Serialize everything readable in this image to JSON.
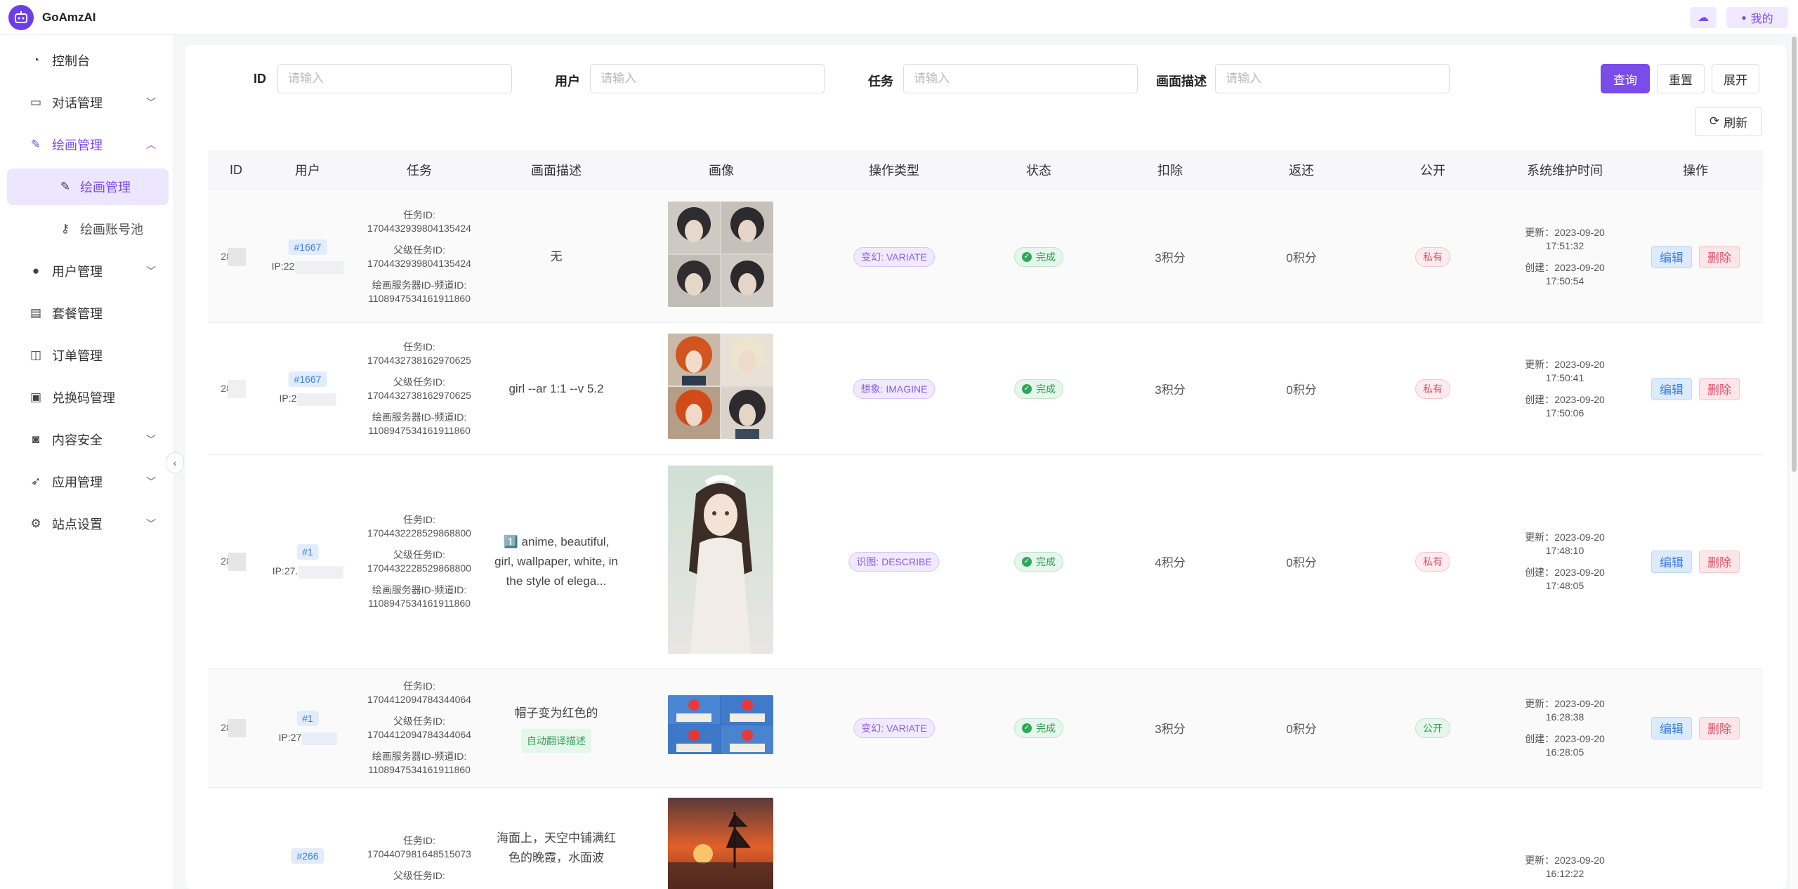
{
  "app": {
    "title": "GoAmzAI",
    "logo_icon": "robot-icon"
  },
  "topbar": {
    "theme_icon": "weather-icon",
    "user_label": "我的"
  },
  "sidebar": {
    "items": [
      {
        "label": "控制台",
        "icon": "dashboard-icon"
      },
      {
        "label": "对话管理",
        "icon": "chat-icon"
      },
      {
        "label": "绘画管理",
        "icon": "paint-icon"
      },
      {
        "label": "绘画管理",
        "icon": "paint-icon"
      },
      {
        "label": "绘画账号池",
        "icon": "key-icon"
      },
      {
        "label": "用户管理",
        "icon": "user-icon"
      },
      {
        "label": "套餐管理",
        "icon": "package-icon"
      },
      {
        "label": "订单管理",
        "icon": "bag-icon"
      },
      {
        "label": "兑换码管理",
        "icon": "gift-icon"
      },
      {
        "label": "内容安全",
        "icon": "shield-icon"
      },
      {
        "label": "应用管理",
        "icon": "rocket-icon"
      },
      {
        "label": "站点设置",
        "icon": "settings-icon"
      }
    ]
  },
  "filters": {
    "id_label": "ID",
    "user_label": "用户",
    "task_label": "任务",
    "desc_label": "画面描述",
    "placeholder": "请输入"
  },
  "buttons": {
    "query": "查询",
    "reset": "重置",
    "expand": "展开",
    "refresh": "刷新"
  },
  "table": {
    "headers": [
      "ID",
      "用户",
      "任务",
      "画面描述",
      "画像",
      "操作类型",
      "状态",
      "扣除",
      "返还",
      "公开",
      "系统维护时间",
      "操作"
    ],
    "task_id_label": "任务ID:",
    "parent_task_label": "父级任务ID:",
    "server_label": "绘画服务器ID-频道ID:",
    "updated_label": "更新：",
    "created_label": "创建：",
    "edit_label": "编辑",
    "delete_label": "删除",
    "rows": [
      {
        "id": "28",
        "user_tag": "#1667",
        "ip": "IP:22",
        "task_id": "1704432939804135424",
        "parent_id": "1704432939804135424",
        "server": "1108947534161911860",
        "desc": "无",
        "auto_tag": "",
        "op": "变幻: VARIATE",
        "status": "完成",
        "deduct": "3积分",
        "refund": "0积分",
        "public": "私有",
        "updated_date": "2023-09-20",
        "updated_time": "17:51:32",
        "created_date": "2023-09-20",
        "created_time": "17:50:54"
      },
      {
        "id": "28",
        "user_tag": "#1667",
        "ip": "IP:2",
        "task_id": "1704432738162970625",
        "parent_id": "1704432738162970625",
        "server": "1108947534161911860",
        "desc": "girl --ar 1:1 --v 5.2",
        "auto_tag": "",
        "op": "想象: IMAGINE",
        "status": "完成",
        "deduct": "3积分",
        "refund": "0积分",
        "public": "私有",
        "updated_date": "2023-09-20",
        "updated_time": "17:50:41",
        "created_date": "2023-09-20",
        "created_time": "17:50:06"
      },
      {
        "id": "28",
        "user_tag": "#1",
        "ip": "IP:27.",
        "task_id": "1704432228529868800",
        "parent_id": "1704432228529868800",
        "server": "1108947534161911860",
        "desc": "1️⃣ anime, beautiful, girl, wallpaper, white, in the style of elega...",
        "auto_tag": "",
        "op": "识图: DESCRIBE",
        "status": "完成",
        "deduct": "4积分",
        "refund": "0积分",
        "public": "私有",
        "updated_date": "2023-09-20",
        "updated_time": "17:48:10",
        "created_date": "2023-09-20",
        "created_time": "17:48:05"
      },
      {
        "id": "28",
        "user_tag": "#1",
        "ip": "IP:27",
        "task_id": "1704412094784344064",
        "parent_id": "1704412094784344064",
        "server": "1108947534161911860",
        "desc": "帽子变为红色的",
        "auto_tag": "自动翻译描述",
        "op": "变幻: VARIATE",
        "status": "完成",
        "deduct": "3积分",
        "refund": "0积分",
        "public": "公开",
        "updated_date": "2023-09-20",
        "updated_time": "16:28:38",
        "created_date": "2023-09-20",
        "created_time": "16:28:05"
      },
      {
        "id": "",
        "user_tag": "#266",
        "ip": "",
        "task_id": "1704407981648515073",
        "parent_id": "",
        "server": "",
        "desc": "海面上，天空中铺满红色的晚霞，水面波",
        "auto_tag": "",
        "op": "",
        "status": "",
        "deduct": "",
        "refund": "",
        "public": "",
        "updated_date": "2023-09-20",
        "updated_time": "16:12:22",
        "created_date": "",
        "created_time": ""
      }
    ]
  },
  "colors": {
    "accent": "#7a4ce8",
    "success": "#2fa758",
    "danger": "#e0506b",
    "link": "#3c7fe0"
  }
}
